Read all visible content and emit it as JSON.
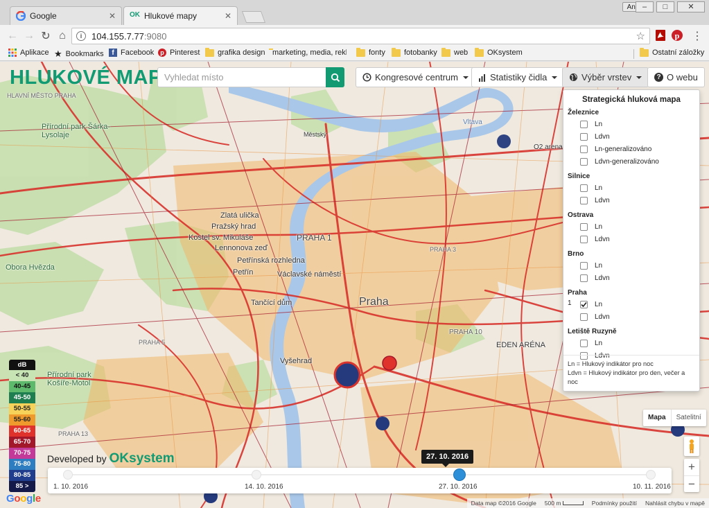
{
  "browser": {
    "tabs": [
      {
        "title": "Google",
        "icon": "google-favicon"
      },
      {
        "title": "Hlukové mapy",
        "icon": "ok-favicon"
      }
    ],
    "user_badge": "Anna",
    "window_controls": [
      "–",
      "□",
      "✕"
    ],
    "address": {
      "host": "104.155.7.77",
      "port": ":9080"
    },
    "bookmarks": [
      {
        "label": "Aplikace",
        "icon": "apps-grid-icon"
      },
      {
        "label": "Bookmarks",
        "icon": "star-icon"
      },
      {
        "label": "Facebook",
        "icon": "facebook-icon"
      },
      {
        "label": "Pinterest",
        "icon": "pinterest-icon"
      },
      {
        "label": "grafika design",
        "icon": "folder-icon"
      },
      {
        "label": "marketing, media, rekl",
        "icon": "folder-icon"
      },
      {
        "label": "fonty",
        "icon": "folder-icon"
      },
      {
        "label": "fotobanky",
        "icon": "folder-icon"
      },
      {
        "label": "web",
        "icon": "folder-icon"
      },
      {
        "label": "OKsystem",
        "icon": "folder-icon"
      }
    ],
    "other_bookmarks": "Ostatní záložky"
  },
  "app": {
    "brand": "HLUKOVÉ MAPY",
    "search_placeholder": "Vyhledat místo",
    "btn_location": "Kongresové centrum",
    "btn_stats": "Statistiky čidla",
    "btn_layers": "Výběr vrstev",
    "btn_about": "O webu",
    "accent_color": "#129b73"
  },
  "layers": {
    "title": "Strategická hluková mapa",
    "groups": [
      {
        "name": "Železnice",
        "items": [
          {
            "label": "Ln",
            "checked": false
          },
          {
            "label": "Ldvn",
            "checked": false
          },
          {
            "label": "Ln-generalizováno",
            "checked": false
          },
          {
            "label": "Ldvn-generalizováno",
            "checked": false
          }
        ]
      },
      {
        "name": "Silnice",
        "items": [
          {
            "label": "Ln",
            "checked": false
          },
          {
            "label": "Ldvn",
            "checked": false
          }
        ]
      },
      {
        "name": "Ostrava",
        "items": [
          {
            "label": "Ln",
            "checked": false
          },
          {
            "label": "Ldvn",
            "checked": false
          }
        ]
      },
      {
        "name": "Brno",
        "items": [
          {
            "label": "Ln",
            "checked": false
          },
          {
            "label": "Ldvn",
            "checked": false
          }
        ]
      },
      {
        "name": "Praha",
        "items": [
          {
            "label": "Ln",
            "checked": true,
            "prefix": "1"
          },
          {
            "label": "Ldvn",
            "checked": false
          }
        ]
      },
      {
        "name": "Letiště Ruzyně",
        "items": [
          {
            "label": "Ln",
            "checked": false
          },
          {
            "label": "Ldvn",
            "checked": false
          }
        ]
      }
    ],
    "note_ln": "Ln = Hlukový indikátor pro noc",
    "note_ldvn": "Ldvn = Hlukový indikátor pro den, večer a noc"
  },
  "map": {
    "type_map": "Mapa",
    "type_sat": "Satelitní",
    "zoom_in": "+",
    "zoom_out": "−",
    "labels": [
      "HLAVNÍ MĚSTO PRAHA",
      "Přírodní park Šárka-Lysolaje",
      "Zlatá ulička",
      "Pražský hrad",
      "Kostel sv. Mikuláše",
      "Lennonova zeď",
      "PRAHA 1",
      "Petřínská rozhledna",
      "Petřín",
      "Václavské náměstí",
      "Tančící dům",
      "Praha",
      "Vyšehrad",
      "EDEN ARÉNA",
      "PRAHA 10",
      "Přírodní park Košíře-Motol",
      "PRAHA 13",
      "PRAHA 5",
      "Obora Hvězda",
      "PRAHA 3",
      "O2 arena",
      "Vltava",
      "Městský"
    ],
    "google": "Google",
    "attribution": [
      "Data map ©2016 Google",
      "500 m",
      "Podmínky použití",
      "Nahlásit chybu v mapě"
    ]
  },
  "legend": {
    "title": "dB",
    "bands": [
      {
        "label": "< 40",
        "color": "#c7e5b4",
        "text": "#222"
      },
      {
        "label": "40-45",
        "color": "#5db96b",
        "text": "#111"
      },
      {
        "label": "45-50",
        "color": "#1f7e4f",
        "text": "#fff"
      },
      {
        "label": "50-55",
        "color": "#f6d25a",
        "text": "#222"
      },
      {
        "label": "55-60",
        "color": "#ef9a2c",
        "text": "#222"
      },
      {
        "label": "60-65",
        "color": "#e0322c",
        "text": "#fff"
      },
      {
        "label": "65-70",
        "color": "#a3172a",
        "text": "#fff"
      },
      {
        "label": "70-75",
        "color": "#c2399a",
        "text": "#fff"
      },
      {
        "label": "75-80",
        "color": "#2f7dc1",
        "text": "#fff"
      },
      {
        "label": "80-85",
        "color": "#1f3d8c",
        "text": "#fff"
      },
      {
        "label": "85 >",
        "color": "#141a4a",
        "text": "#fff"
      }
    ]
  },
  "developed": {
    "prefix": "Developed by",
    "brand": "OKsystem"
  },
  "timeline": {
    "current": "27. 10. 2016",
    "current_fraction": 0.67,
    "ticks": [
      "1. 10. 2016",
      "14. 10. 2016",
      "27. 10. 2016",
      "10. 11. 2016"
    ]
  },
  "sensors": [
    {
      "name": "sensor-marker",
      "color": "#243a7c"
    },
    {
      "name": "sensor-marker-selected",
      "color": "#243a7c"
    },
    {
      "name": "sensor-marker-alert",
      "color": "#e0322c"
    }
  ]
}
